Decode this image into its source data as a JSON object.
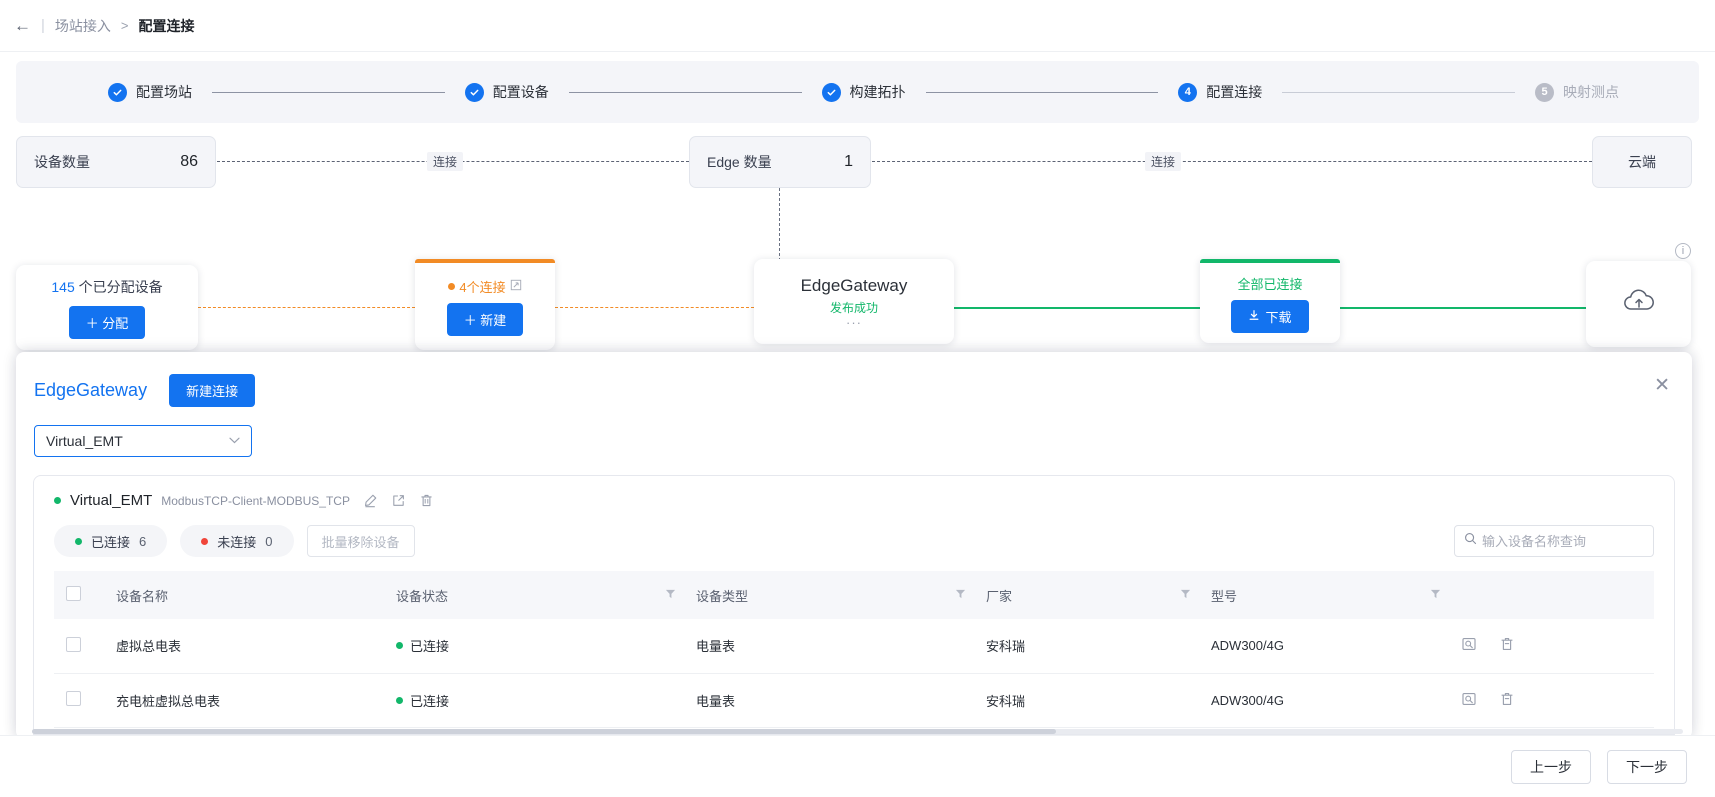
{
  "breadcrumb": {
    "back_icon": "arrow-left-icon",
    "parent": "场站接入",
    "separator": ">",
    "current": "配置连接"
  },
  "steps": [
    {
      "label": "配置场站",
      "badge": "check",
      "state": "done"
    },
    {
      "label": "配置设备",
      "badge": "check",
      "state": "done"
    },
    {
      "label": "构建拓扑",
      "badge": "check",
      "state": "done"
    },
    {
      "label": "配置连接",
      "badge": "4",
      "state": "active"
    },
    {
      "label": "映射测点",
      "badge": "5",
      "state": "todo"
    }
  ],
  "topology": {
    "devices_box": {
      "label": "设备数量",
      "value": "86"
    },
    "edge_box": {
      "label": "Edge 数量",
      "value": "1"
    },
    "cloud_box": {
      "label": "云端"
    },
    "link_label_left": "连接",
    "link_label_right": "连接",
    "alloc_card": {
      "count": "145",
      "text": "个已分配设备",
      "button": "＋ 分配"
    },
    "conn_card": {
      "text": "4个连接",
      "expand_icon": "expand-icon",
      "button": "＋ 新建"
    },
    "gateway_card": {
      "title": "EdgeGateway",
      "status": "发布成功",
      "more": "···"
    },
    "allconn_card": {
      "text": "全部已连接",
      "button": "下载"
    },
    "cloud_card_icon": "cloud-upload-icon",
    "info_icon": "info-icon"
  },
  "panel": {
    "title": "EdgeGateway",
    "new_connection_button": "新建连接",
    "close_icon": "close-icon",
    "select": {
      "value": "Virtual_EMT",
      "caret_icon": "chevron-down-icon"
    },
    "connection": {
      "name": "Virtual_EMT",
      "protocol": "ModbusTCP-Client-MODBUS_TCP",
      "edit_icon": "pencil-icon",
      "copy_icon": "export-icon",
      "delete_icon": "trash-icon",
      "pills": [
        {
          "label": "已连接",
          "value": "6",
          "dot": "green"
        },
        {
          "label": "未连接",
          "value": "0",
          "dot": "red"
        }
      ],
      "batch_remove_button": "批量移除设备",
      "search": {
        "placeholder": "输入设备名称查询",
        "value": "",
        "icon": "search-icon"
      }
    },
    "table": {
      "columns": [
        "设备名称",
        "设备状态",
        "设备类型",
        "厂家",
        "型号"
      ],
      "filter_icon": "filter-icon",
      "rows": [
        {
          "name": "虚拟总电表",
          "state": "已连接",
          "state_dot": "green",
          "type": "电量表",
          "vendor": "安科瑞",
          "model": "ADW300/4G",
          "view_icon": "view-icon",
          "remove_icon": "remove-icon"
        },
        {
          "name": "充电桩虚拟总电表",
          "state": "已连接",
          "state_dot": "green",
          "type": "电量表",
          "vendor": "安科瑞",
          "model": "ADW300/4G",
          "view_icon": "view-icon",
          "remove_icon": "remove-icon"
        }
      ]
    }
  },
  "footer": {
    "prev": "上一步",
    "next": "下一步"
  },
  "colors": {
    "primary": "#1373f0",
    "success": "#12b76a",
    "warning": "#f28b25",
    "danger": "#f0453a"
  }
}
